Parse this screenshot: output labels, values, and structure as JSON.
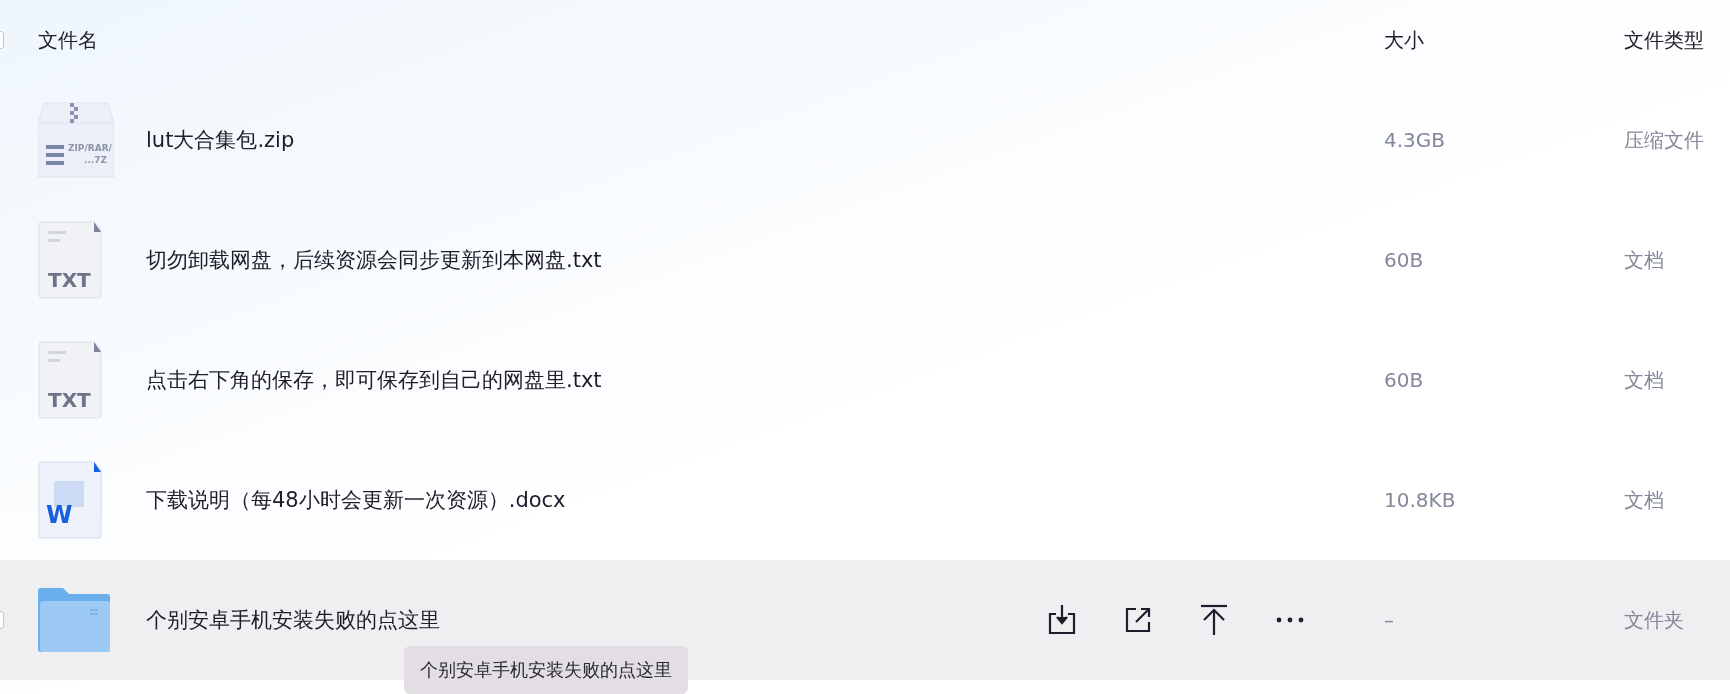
{
  "header": {
    "checkbox": {
      "checked": false
    },
    "columns": [
      "文件名",
      "大小",
      "文件类型"
    ]
  },
  "rows": [
    {
      "kind": "zip",
      "icon_label": "ZIP/RAR/\n...7Z",
      "name": "lut大合集包.zip",
      "size": "4.3GB",
      "type": "压缩文件",
      "selected": false
    },
    {
      "kind": "txt",
      "icon_label": "TXT",
      "name": "切勿卸载网盘，后续资源会同步更新到本网盘.txt",
      "size": "60B",
      "type": "文档",
      "selected": false
    },
    {
      "kind": "txt",
      "icon_label": "TXT",
      "name": "点击右下角的保存，即可保存到自己的网盘里.txt",
      "size": "60B",
      "type": "文档",
      "selected": false
    },
    {
      "kind": "docx",
      "icon_label": "W",
      "name": "下载说明（每48小时会更新一次资源）.docx",
      "size": "10.8KB",
      "type": "文档",
      "selected": false
    },
    {
      "kind": "folder",
      "name": "个别安卓手机安装失败的点这里",
      "size": "–",
      "type": "文件夹",
      "selected": true,
      "checkbox": {
        "checked": false
      },
      "actions": [
        {
          "kind": "download"
        },
        {
          "kind": "share"
        },
        {
          "kind": "top"
        },
        {
          "kind": "more"
        }
      ]
    }
  ],
  "tooltip": {
    "text": "个别安卓手机安装失败的点这里"
  }
}
